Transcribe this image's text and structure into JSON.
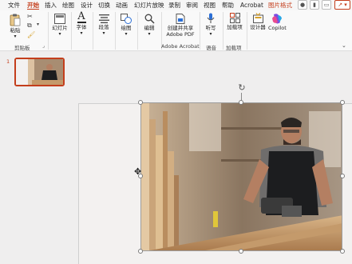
{
  "tabs": [
    {
      "label": "文件"
    },
    {
      "label": "开始"
    },
    {
      "label": "插入"
    },
    {
      "label": "绘图"
    },
    {
      "label": "设计"
    },
    {
      "label": "切换"
    },
    {
      "label": "动画"
    },
    {
      "label": "幻灯片放映"
    },
    {
      "label": "录制"
    },
    {
      "label": "审阅"
    },
    {
      "label": "视图"
    },
    {
      "label": "帮助"
    },
    {
      "label": "Acrobat"
    },
    {
      "label": "图片格式"
    }
  ],
  "ribbon": {
    "paste": "粘贴",
    "clipboard_group": "剪贴板",
    "slides": "幻灯片",
    "font": "字体",
    "paragraph": "段落",
    "drawing": "绘图",
    "editing": "编辑",
    "create_share_pdf_line1": "创建并共享",
    "create_share_pdf_line2": "Adobe PDF",
    "acrobat_group": "Adobe Acrobat",
    "dictate": "听写",
    "voice_group": "语音",
    "addins": "加载项",
    "addins_line2": "项",
    "addins_group": "加载项",
    "designer": "设计器",
    "designer_line2": "器",
    "copilot": "Copilot"
  },
  "thumbnails": [
    {
      "number": "1"
    }
  ],
  "colors": {
    "accent": "#c43e1c",
    "photo_wall": "#a88d72",
    "shirt": "#1c1d1f"
  }
}
